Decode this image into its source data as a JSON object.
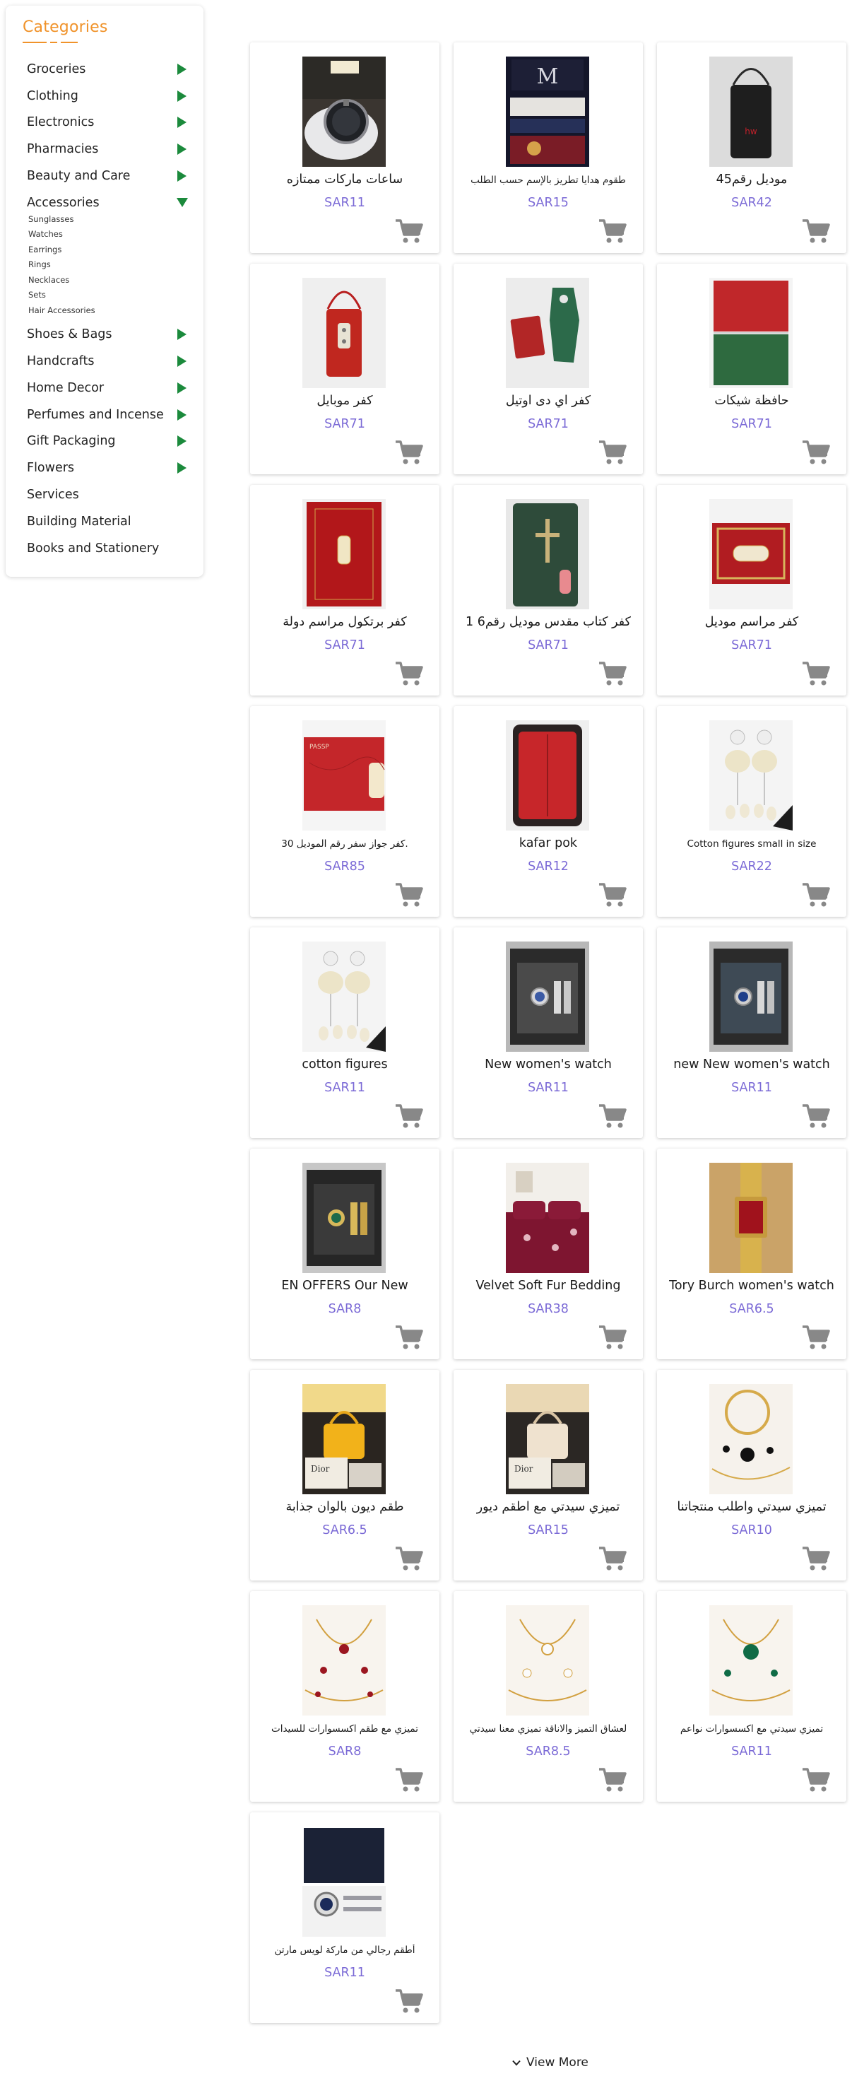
{
  "sidebar": {
    "title": "Categories",
    "categories": [
      {
        "label": "Groceries",
        "expanded": false
      },
      {
        "label": "Clothing",
        "expanded": false
      },
      {
        "label": "Electronics",
        "expanded": false
      },
      {
        "label": "Pharmacies",
        "expanded": false
      },
      {
        "label": "Beauty and Care",
        "expanded": false
      },
      {
        "label": "Accessories",
        "expanded": true,
        "subcategories": [
          "Sunglasses",
          "Watches",
          "Earrings",
          "Rings",
          "Necklaces",
          "Sets",
          "Hair Accessories"
        ]
      },
      {
        "label": "Shoes & Bags",
        "expanded": false
      },
      {
        "label": "Handcrafts",
        "expanded": false
      },
      {
        "label": "Home Decor",
        "expanded": false
      },
      {
        "label": "Perfumes and Incense",
        "expanded": false
      },
      {
        "label": "Gift Packaging",
        "expanded": false
      },
      {
        "label": "Flowers",
        "expanded": false
      },
      {
        "label": "Services",
        "expanded": null
      },
      {
        "label": "Building Material",
        "expanded": null
      },
      {
        "label": "Books and Stationery",
        "expanded": null
      }
    ]
  },
  "products": [
    {
      "name": "ساعات ماركات ممتازه",
      "price": "SAR11",
      "image": "watch-in-box"
    },
    {
      "name": "طقوم هدايا تطريز بالإسم حسب الطلب",
      "price": "SAR15",
      "image": "embroidered-gift-set"
    },
    {
      "name": "موديل رقم45",
      "price": "SAR42",
      "image": "black-phone-pouch"
    },
    {
      "name": "كفر موبايل",
      "price": "SAR71",
      "image": "red-phone-case"
    },
    {
      "name": "كفر اي دى اوتيل",
      "price": "SAR71",
      "image": "red-green-leather-pieces"
    },
    {
      "name": "حافظة شيكات",
      "price": "SAR71",
      "image": "red-green-cheque-holders"
    },
    {
      "name": "كفر برتكول مراسم دولة",
      "price": "SAR71",
      "image": "red-protocol-cover"
    },
    {
      "name": "كفر كتاب مقدس موديل رقم6 1",
      "price": "SAR71",
      "image": "green-bible-cover"
    },
    {
      "name": "كفر مراسم موديل",
      "price": "SAR71",
      "image": "red-gold-ceremony-cover"
    },
    {
      "name": "كفر جواز سفر رقم الموديل 30.",
      "price": "SAR85",
      "image": "red-passport-cover"
    },
    {
      "name": "kafar pok",
      "price": "SAR12",
      "image": "red-zip-folio"
    },
    {
      "name": "Cotton figures small in size",
      "price": "SAR22",
      "image": "cotton-figures"
    },
    {
      "name": "cotton figures",
      "price": "SAR11",
      "image": "cotton-figures"
    },
    {
      "name": "New women's watch",
      "price": "SAR11",
      "image": "women-watch-box-silver"
    },
    {
      "name": "new New women's watch",
      "price": "SAR11",
      "image": "women-watch-box-blue"
    },
    {
      "name": "EN OFFERS Our New",
      "price": "SAR8",
      "image": "watch-box-green-gold"
    },
    {
      "name": "Velvet Soft Fur Bedding",
      "price": "SAR38",
      "image": "maroon-bedding"
    },
    {
      "name": "Tory Burch women's watch",
      "price": "SAR6.5",
      "image": "gold-square-watch"
    },
    {
      "name": "طقم ديون بالوان جذابة",
      "price": "SAR6.5",
      "image": "yellow-handbag"
    },
    {
      "name": "تميزي سيدتي مع اطقم ديور",
      "price": "SAR15",
      "image": "cream-handbag"
    },
    {
      "name": "تميزي سيدتي واطلب منتجاتنا",
      "price": "SAR10",
      "image": "black-gold-jewelry"
    },
    {
      "name": "تميزي مع طقم اكسسوارات للسيدات",
      "price": "SAR8",
      "image": "red-gold-jewelry"
    },
    {
      "name": "لعشاق التميز والاناقة تميزي معنا سيدتي",
      "price": "SAR8.5",
      "image": "white-gold-jewelry"
    },
    {
      "name": "تميزي سيدتي مع اكسسوارات نواعم",
      "price": "SAR11",
      "image": "green-gold-jewelry"
    },
    {
      "name": "أطقم رجالي من ماركة لويس مارتن",
      "price": "SAR11",
      "image": "mens-watch-pen-set"
    }
  ],
  "view_more": "View More",
  "colors": {
    "accent": "#f0932b",
    "price": "#7b6ad6",
    "arrow": "#1b8a3c",
    "cart": "#888888"
  }
}
